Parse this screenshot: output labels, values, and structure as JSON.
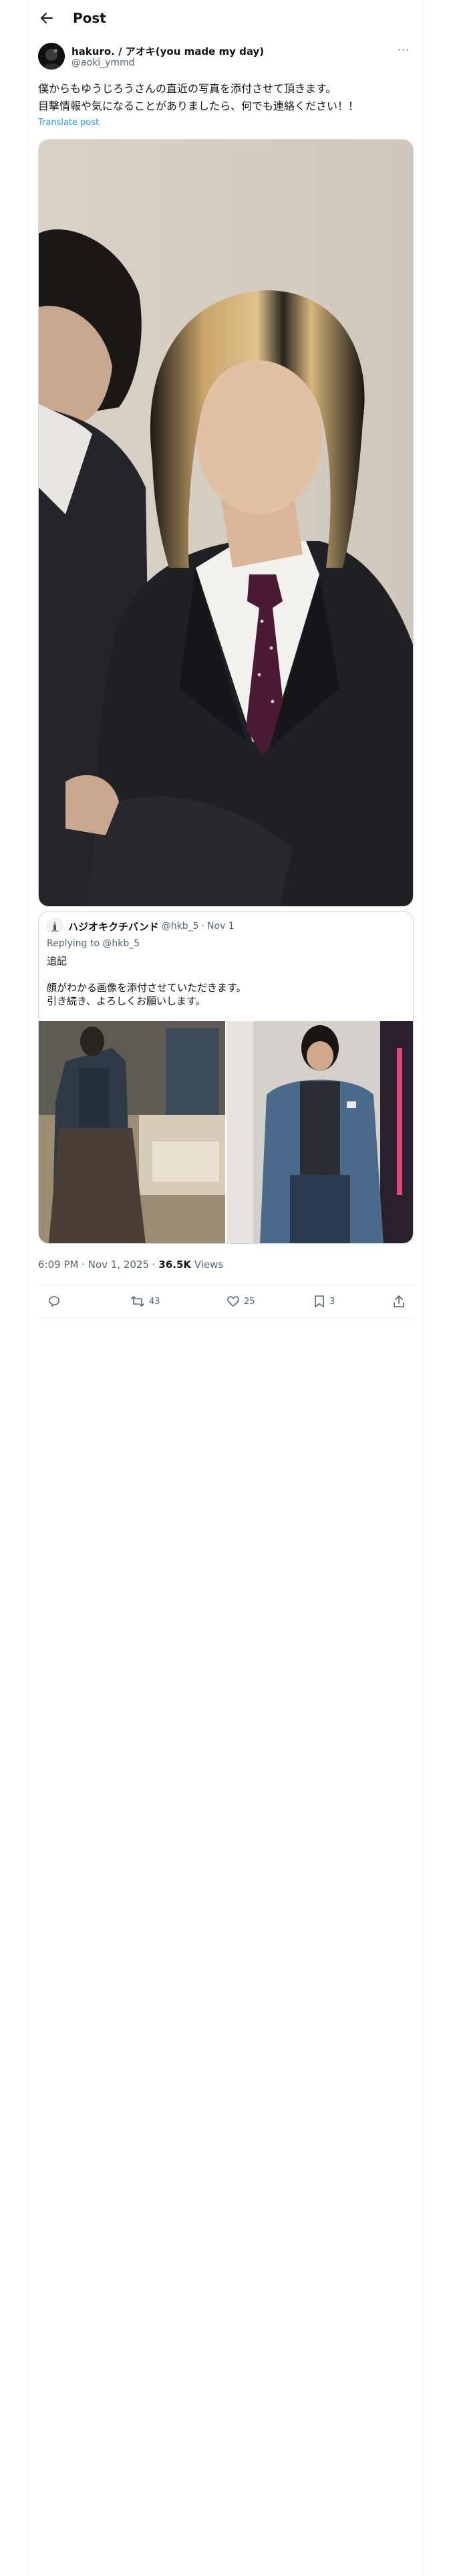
{
  "header": {
    "title": "Post",
    "back_icon": "arrow-left-icon"
  },
  "author": {
    "name": "hakuro. / アオキ(you made my day)",
    "handle": "@aoki_ymmd",
    "more_label": "···"
  },
  "tweet": {
    "lines": [
      "僕からもゆうじろうさんの直近の写真を添付させて頂きます。",
      "目撃情報や気になることがありましたら、何でも連絡ください！！"
    ],
    "translate_label": "Translate post"
  },
  "quote": {
    "name": "ハジオキクチバンド",
    "handle": "@hkb_5",
    "separator": "·",
    "date": "Nov 1",
    "reply_prefix": "Replying to",
    "reply_mention": "@hkb_5",
    "body_lines": [
      "追記",
      "",
      "顔がわかる画像を添付させていただきます。",
      "引き続き、よろしくお願いします。"
    ]
  },
  "meta": {
    "time": "6:09 PM · Nov 1, 2025",
    "separator": "·",
    "views_count": "36.5K",
    "views_label": "Views"
  },
  "actions": {
    "reply": {
      "icon": "reply-icon",
      "count": ""
    },
    "repost": {
      "icon": "repost-icon",
      "count": "43"
    },
    "like": {
      "icon": "heart-icon",
      "count": "25"
    },
    "bookmark": {
      "icon": "bookmark-icon",
      "count": "3"
    },
    "share": {
      "icon": "share-icon",
      "count": ""
    }
  },
  "colors": {
    "text": "#0f1419",
    "secondary": "#536471",
    "accent": "#1d9bf0",
    "border": "#cfd9de"
  }
}
